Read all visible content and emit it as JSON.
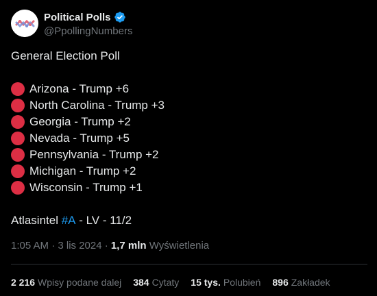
{
  "account": {
    "display_name": "Political Polls",
    "handle": "@PpollingNumbers"
  },
  "post": {
    "title": "General Election Poll",
    "results": [
      {
        "text": "Arizona - Trump +6"
      },
      {
        "text": "North Carolina - Trump +3"
      },
      {
        "text": "Georgia - Trump +2"
      },
      {
        "text": "Nevada - Trump +5"
      },
      {
        "text": "Pennsylvania - Trump +2"
      },
      {
        "text": "Michigan - Trump +2"
      },
      {
        "text": "Wisconsin - Trump +1"
      }
    ],
    "bullet_color": "#dd2e44",
    "source_prefix": "Atlasintel ",
    "source_hashtag": "#A",
    "source_suffix": " - LV - 11/2"
  },
  "meta": {
    "time_date": "1:05 AM · 3 lis 2024 · ",
    "views_count": "1,7 mln",
    "views_label": " Wyświetlenia"
  },
  "stats": [
    {
      "count": "2 216",
      "label": "Wpisy podane dalej"
    },
    {
      "count": "384",
      "label": "Cytaty"
    },
    {
      "count": "15 tys.",
      "label": "Polubień"
    },
    {
      "count": "896",
      "label": "Zakładek"
    }
  ],
  "colors": {
    "background": "#000000",
    "text": "#e7e9ea",
    "muted": "#71767b",
    "link": "#1d9bf0",
    "verified": "#1d9bf0"
  }
}
